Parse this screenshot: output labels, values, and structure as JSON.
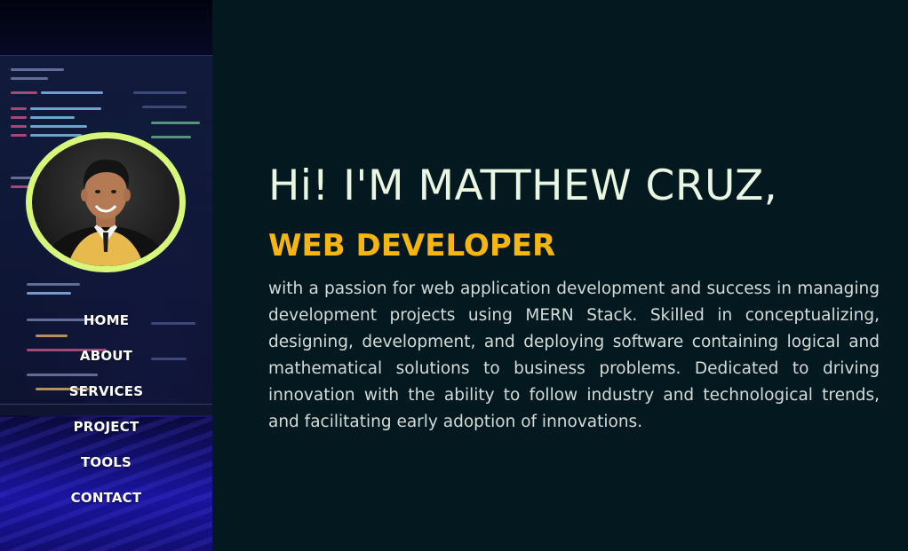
{
  "nav": {
    "items": [
      {
        "label": "HOME"
      },
      {
        "label": "ABOUT"
      },
      {
        "label": "SERVICES"
      },
      {
        "label": "PROJECT"
      },
      {
        "label": "TOOLS"
      },
      {
        "label": "CONTACT"
      }
    ]
  },
  "hero": {
    "greeting": "Hi! I'M MATTHEW CRUZ,",
    "role": "WEB DEVELOPER",
    "bio": "with a passion for web application development and success in managing development projects using MERN Stack. Skilled in conceptualizing, designing, development, and deploying software containing logical and mathematical solutions to business problems. Dedicated to driving innovation with the ability to follow industry and technological trends, and facilitating early adoption of innovations."
  },
  "colors": {
    "background": "#04181f",
    "accent": "#f6b60f",
    "avatar_ring": "#d6f779",
    "heading": "#e9f6e2",
    "body_text": "#d4dcd9"
  }
}
